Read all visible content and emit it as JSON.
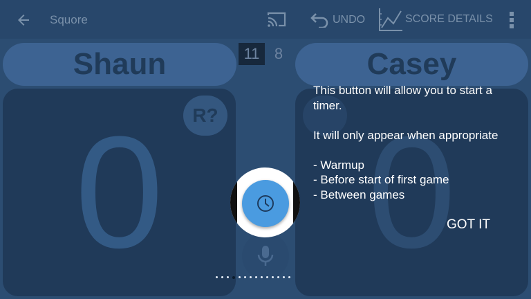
{
  "appbar": {
    "title": "Squore",
    "undo_label": "UNDO",
    "score_details_label": "SCORE DETAILS",
    "icons": [
      "arrow-back-icon",
      "cast-icon",
      "undo-icon",
      "score-chart-icon",
      "more-vert-icon"
    ]
  },
  "players": {
    "left": {
      "name": "Shaun",
      "games": "11",
      "score": "0",
      "badge": "R?"
    },
    "right": {
      "name": "Casey",
      "games": "8",
      "score": "0"
    }
  },
  "tutorial": {
    "line1": "This button will allow you to start a timer.",
    "line2": "It will only appear when appropriate",
    "bullet1": "- Warmup",
    "bullet2": "- Before start of first game",
    "bullet3": "- Between games",
    "dismiss_label": "GOT IT",
    "page_count": 14,
    "active_page": 4
  },
  "colors": {
    "timer_button": "#4a9be0",
    "app_bar": "#28476b",
    "panel": "#203a59"
  }
}
